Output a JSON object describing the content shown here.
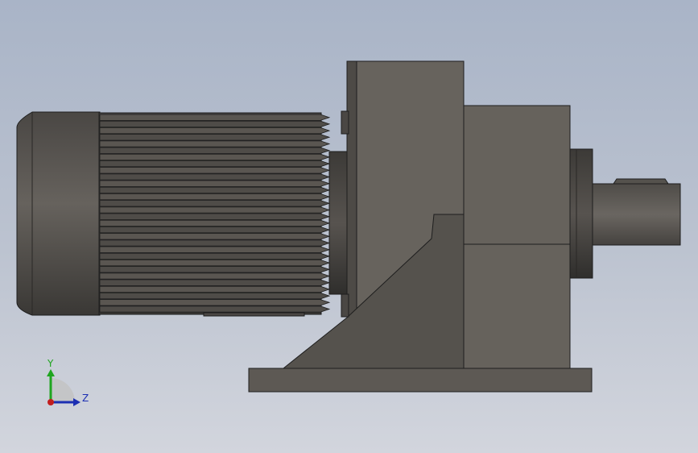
{
  "viewport": {
    "background_top": "#a9b4c7",
    "background_bottom": "#d2d5dd"
  },
  "model": {
    "icon": "gearmotor-model",
    "body_color": "#5f5b56",
    "edge_color": "#1e1e1e"
  },
  "triad": {
    "y_label": "Y",
    "z_label": "Z",
    "y_color": "#1fa51f",
    "z_color": "#1c2fb3",
    "x_color": "#c21e1e"
  }
}
